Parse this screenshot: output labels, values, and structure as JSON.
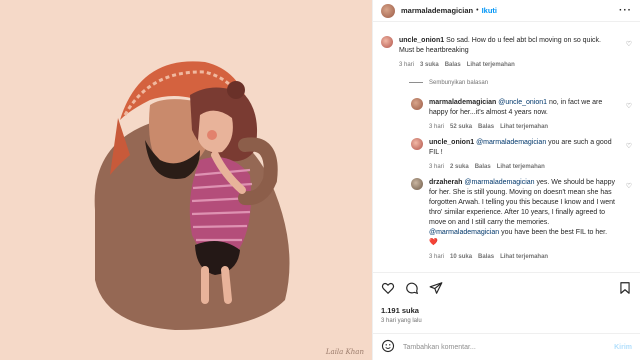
{
  "header": {
    "username": "marmalademagician",
    "separator": "•",
    "follow_label": "Ikuti",
    "more_label": "···"
  },
  "comments": [
    {
      "username": "uncle_onion1",
      "text": "So sad. How do u feel abt bcl moving on so quick. Must be heartbreaking",
      "time": "3 hari",
      "likes": "3 suka",
      "reply": "Balas",
      "translate": "Lihat terjemahan"
    },
    {
      "hide_replies": "Sembunyikan balasan"
    },
    {
      "username": "marmalademagician",
      "mention": "@uncle_onion1",
      "text": " no, in fact we are happy for her...it's almost 4 years now.",
      "time": "3 hari",
      "likes": "52 suka",
      "reply": "Balas",
      "translate": "Lihat terjemahan"
    },
    {
      "username": "uncle_onion1",
      "mention": "@marmalademagician",
      "text": " you are such a good FIL !",
      "time": "3 hari",
      "likes": "2 suka",
      "reply": "Balas",
      "translate": "Lihat terjemahan"
    },
    {
      "username": "drzaherah",
      "mention": "@marmalademagician",
      "text": " yes. We should be happy for her. She is still young. Moving on doesn't mean she has forgotten Arwah. I telling you this because I know and I went thro' similar experience. After 10 years, I finally agreed to move on and I still carry the memories. ",
      "mention2": "@marmalademagician",
      "text2": " you have been the best FIL to her. ❤️",
      "time": "3 hari",
      "likes": "10 suka",
      "reply": "Balas",
      "translate": "Lihat terjemahan"
    }
  ],
  "footer": {
    "likes": "1.191 suka",
    "time": "3 hari yang lalu",
    "comment_placeholder": "Tambahkan komentar...",
    "post_label": "Kirim"
  },
  "artwork_signature": "Laila Khan",
  "colors": {
    "link": "#0095f6",
    "mention": "#00376b",
    "muted": "#737373",
    "post_disabled": "#b2dffc",
    "artwork_bg": "#f5d9c8"
  },
  "icons": [
    "heart-icon",
    "comment-icon",
    "share-icon",
    "bookmark-icon",
    "emoji-icon",
    "more-icon"
  ]
}
